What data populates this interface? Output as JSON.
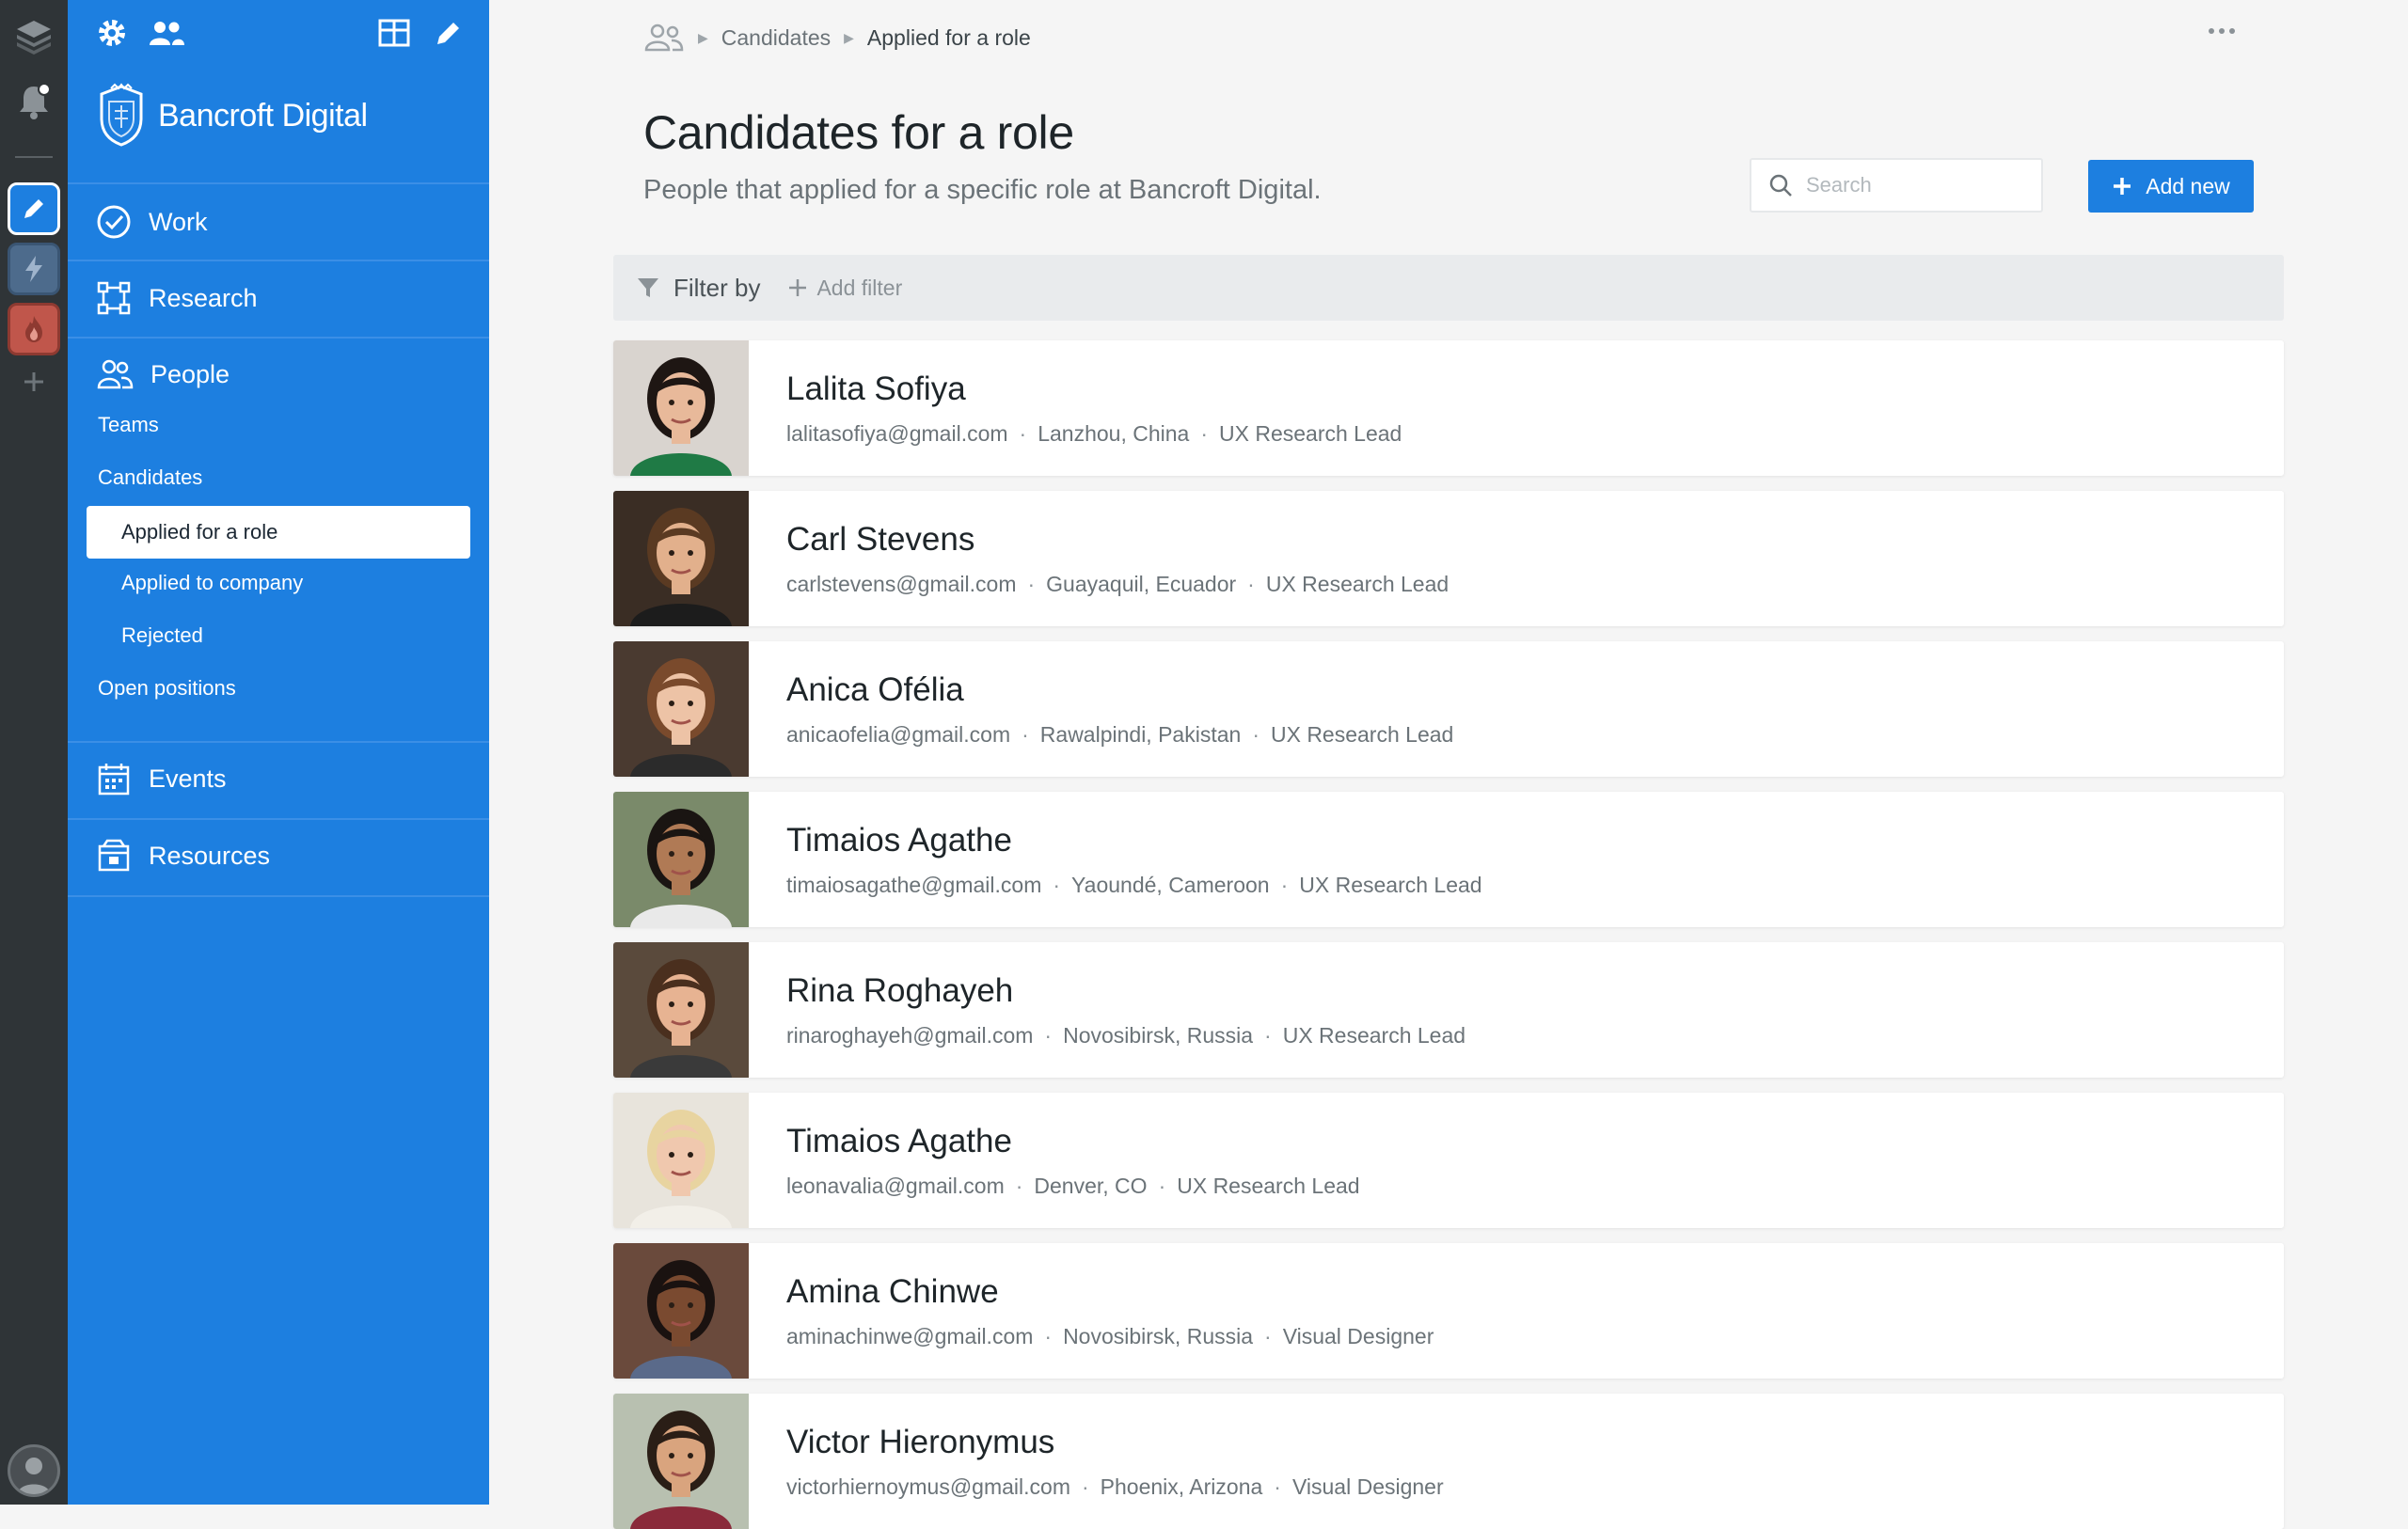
{
  "rail": {
    "workspaces": [
      {
        "name": "edit",
        "color": "#1d7fe0"
      },
      {
        "name": "bolt",
        "color": "#4d6b8c"
      },
      {
        "name": "flame",
        "color": "#c0564b"
      }
    ]
  },
  "sidebar": {
    "brand": "Bancroft Digital",
    "nav": {
      "work": "Work",
      "research": "Research",
      "people": "People",
      "teams": "Teams",
      "candidates": "Candidates",
      "applied_role": "Applied for a role",
      "applied_company": "Applied to company",
      "rejected": "Rejected",
      "open_positions": "Open positions",
      "events": "Events",
      "resources": "Resources"
    }
  },
  "breadcrumb": {
    "items": [
      "Candidates",
      "Applied for a role"
    ]
  },
  "page": {
    "title": "Candidates for a role",
    "subtitle": "People that applied for a specific role at Bancroft Digital."
  },
  "search": {
    "placeholder": "Search"
  },
  "actions": {
    "add_new": "Add new"
  },
  "filter": {
    "label": "Filter by",
    "add_filter": "Add filter"
  },
  "candidates": [
    {
      "name": "Lalita Sofiya",
      "email": "lalitasofiya@gmail.com",
      "location": "Lanzhou, China",
      "role": "UX Research Lead",
      "skin": "#e8b99a",
      "hair": "#1e1613",
      "shirt": "#1f7a45",
      "bg": "#d9d4cf"
    },
    {
      "name": "Carl Stevens",
      "email": "carlstevens@gmail.com",
      "location": "Guayaquil, Ecuador",
      "role": "UX Research Lead",
      "skin": "#e2b08c",
      "hair": "#5a3a22",
      "shirt": "#1c1c1c",
      "bg": "#3a2d24"
    },
    {
      "name": "Anica Ofélia",
      "email": "anicaofelia@gmail.com",
      "location": "Rawalpindi, Pakistan",
      "role": "UX Research Lead",
      "skin": "#edc3a6",
      "hair": "#7a4a2c",
      "shirt": "#2b2b2b",
      "bg": "#4a3a30"
    },
    {
      "name": "Timaios Agathe",
      "email": "timaiosagathe@gmail.com",
      "location": "Yaoundé, Cameroon",
      "role": "UX Research Lead",
      "skin": "#b07a55",
      "hair": "#1a1512",
      "shirt": "#e9e9e9",
      "bg": "#7a8a6a"
    },
    {
      "name": "Rina Roghayeh",
      "email": "rinaroghayeh@gmail.com",
      "location": "Novosibirsk, Russia",
      "role": "UX Research Lead",
      "skin": "#e7b392",
      "hair": "#4a2f1e",
      "shirt": "#3a3a3a",
      "bg": "#5a4a3c"
    },
    {
      "name": "Timaios Agathe",
      "email": "leonavalia@gmail.com",
      "location": "Denver, CO",
      "role": "UX Research Lead",
      "skin": "#f0c8ae",
      "hair": "#e8d4a0",
      "shirt": "#f2efe8",
      "bg": "#e8e4dc"
    },
    {
      "name": "Amina Chinwe",
      "email": "aminachinwe@gmail.com",
      "location": "Novosibirsk, Russia",
      "role": "Visual Designer",
      "skin": "#7a4a30",
      "hair": "#1a1210",
      "shirt": "#5a6a8a",
      "bg": "#6a4a3c"
    },
    {
      "name": "Victor Hieronymus",
      "email": "victorhiernoymus@gmail.com",
      "location": "Phoenix, Arizona",
      "role": "Visual Designer",
      "skin": "#d9a47e",
      "hair": "#2a1e16",
      "shirt": "#8a2a3a",
      "bg": "#b8c0b0"
    }
  ]
}
